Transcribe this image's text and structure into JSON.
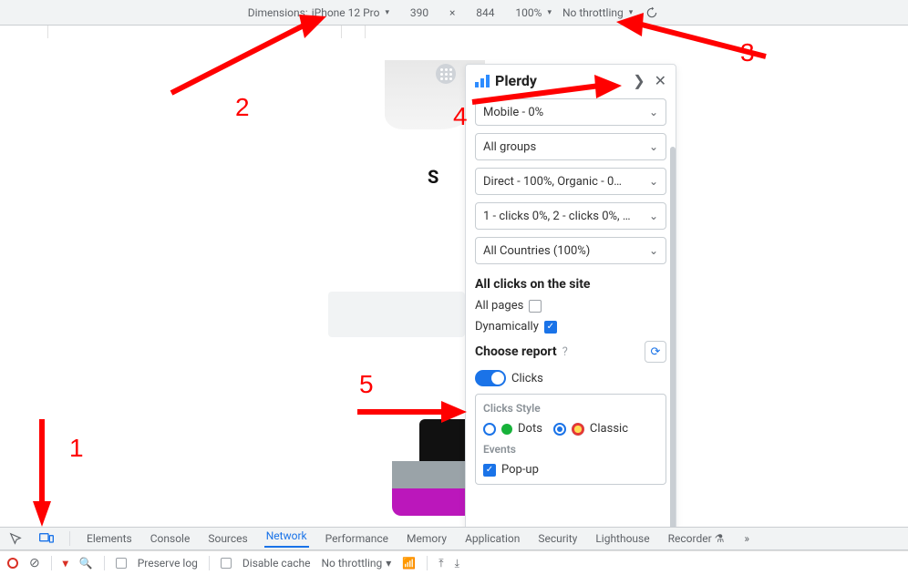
{
  "device_bar": {
    "dimensions_label": "Dimensions:",
    "device_name": "iPhone 12 Pro",
    "width": "390",
    "height": "844",
    "zoom": "100%",
    "throttling": "No throttling"
  },
  "plerdy": {
    "brand": "Plerdy",
    "selects": {
      "device": "Mobile - 0%",
      "groups": "All groups",
      "traffic": "Direct - 100%, Organic - 0…",
      "clicks": "1 - clicks 0%, 2 - clicks 0%, …",
      "countries": "All Countries (100%)"
    },
    "section_title": "All clicks on the site",
    "all_pages_label": "All pages",
    "dynamically_label": "Dynamically",
    "choose_report_label": "Choose report",
    "clicks_label": "Clicks",
    "style": {
      "heading": "Clicks Style",
      "dots": "Dots",
      "classic": "Classic"
    },
    "events": {
      "heading": "Events",
      "popup": "Pop-up"
    }
  },
  "devtools": {
    "tabs": [
      "Elements",
      "Console",
      "Sources",
      "Network",
      "Performance",
      "Memory",
      "Application",
      "Security",
      "Lighthouse",
      "Recorder"
    ],
    "active_tab": "Network",
    "filter": {
      "preserve_log": "Preserve log",
      "disable_cache": "Disable cache",
      "throttling": "No throttling"
    }
  },
  "annotations": {
    "n1": "1",
    "n2": "2",
    "n3": "3",
    "n4": "4",
    "n5": "5"
  }
}
